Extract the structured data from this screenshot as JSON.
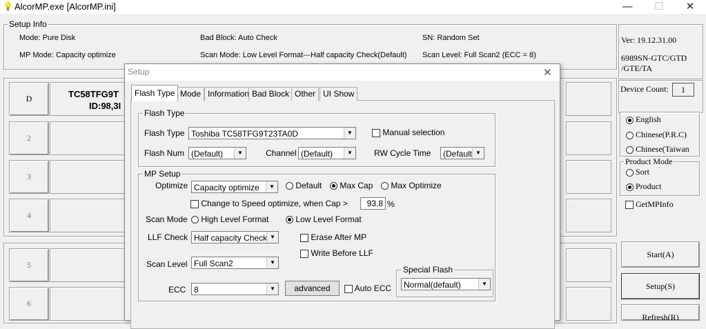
{
  "window": {
    "title": "AlcorMP.exe [AlcorMP.ini]",
    "minimize": "—",
    "maximize": "☐",
    "close": "✕"
  },
  "setup_info": {
    "legend": "Setup Info",
    "mode": "Mode: Pure Disk",
    "mp_mode": "MP Mode: Capacity optimize",
    "bad_block": "Bad Block: Auto Check",
    "scan_mode": "Scan Mode: Low Level Format---Half capacity Check(Default)",
    "sn": "SN: Random Set",
    "scan_level": "Scan Level: Full Scan2 (ECC = 8)"
  },
  "slots": {
    "top": [
      {
        "label": "D",
        "info1": "TC58TFG9T",
        "info2": "ID:98,3I"
      },
      {
        "label": "2"
      },
      {
        "label": "3"
      },
      {
        "label": "4"
      }
    ],
    "bottom": [
      {
        "label": "5"
      },
      {
        "label": "6"
      }
    ]
  },
  "right_panel": {
    "version": "Ver: 19.12.31.00",
    "chip_line1": "6989SN-GTC/GTD",
    "chip_line2": "/GTE/TA",
    "device_count_label": "Device Count:",
    "device_count_value": "1",
    "languages": [
      {
        "label": "English",
        "selected": true
      },
      {
        "label": "Chinese(P.R.C)",
        "selected": false
      },
      {
        "label": "Chinese(Taiwan",
        "selected": false
      }
    ],
    "product_mode_legend": "Product Mode",
    "product_modes": [
      {
        "label": "Sort",
        "selected": false
      },
      {
        "label": "Product",
        "selected": true
      }
    ],
    "get_mp_info": "GetMPInfo",
    "start_button": "Start(A)",
    "setup_button": "Setup(S)",
    "refresh_button": "Refresh(R)"
  },
  "dialog": {
    "title": "Setup",
    "close": "✕",
    "tabs": [
      "Flash Type",
      "Mode",
      "Information",
      "Bad Block",
      "Other",
      "UI Show"
    ],
    "active_tab": "Flash Type",
    "flash_type_group": {
      "legend": "Flash Type",
      "flash_type_label": "Flash Type",
      "flash_type_value": "Toshiba TC58TFG9T23TA0D",
      "manual_selection": "Manual selection",
      "flash_num_label": "Flash Num",
      "flash_num_value": "(Default)",
      "channel_label": "Channel",
      "channel_value": "(Default)",
      "rw_cycle_label": "RW Cycle Time",
      "rw_cycle_value": "(Default)"
    },
    "mp_setup": {
      "legend": "MP Setup",
      "optimize_label": "Optimize",
      "optimize_value": "Capacity optimize",
      "opt_default": "Default",
      "opt_max_cap": "Max Cap",
      "opt_max_optimize": "Max Optimize",
      "change_speed": "Change to Speed optimize, when Cap  >",
      "cap_value": "93.8",
      "cap_unit": "%",
      "scan_mode_label": "Scan Mode",
      "high_level": "High Level Format",
      "low_level": "Low Level Format",
      "llf_check_label": "LLF Check",
      "llf_check_value": "Half capacity Check(D",
      "erase_after_mp": "Erase After MP",
      "write_before_llf": "Write Before LLF",
      "scan_level_label": "Scan Level",
      "scan_level_value": "Full Scan2",
      "ecc_label": "ECC",
      "ecc_value": "8",
      "advanced_button": "advanced",
      "auto_ecc": "Auto ECC",
      "special_flash_legend": "Special Flash",
      "special_flash_value": "Normal(default)"
    }
  }
}
